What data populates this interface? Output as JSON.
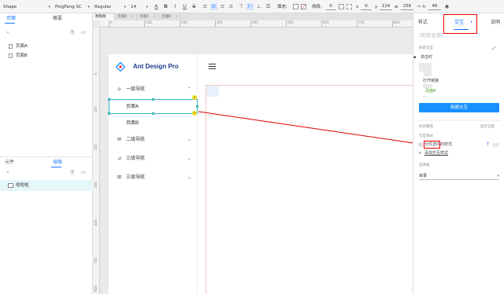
{
  "toolbar": {
    "shape_select": "Shape",
    "font_family": "PingFang SC",
    "font_weight": "Regular",
    "font_size": "14",
    "fill_label": "填充:",
    "stroke_label": "线段:",
    "stroke_width": "0",
    "x_value": "0",
    "y_value": "124",
    "w_value": "256",
    "h_value": "46",
    "icons": [
      "text-color-icon",
      "bold-icon",
      "italic-icon",
      "underline-icon",
      "strikethrough-icon",
      "align-left-icon",
      "align-center-icon",
      "align-right-icon",
      "align-justify-icon",
      "valign-top-icon",
      "valign-middle-icon",
      "valign-bottom-icon",
      "list-icon",
      "lock-icon",
      "eye-icon"
    ]
  },
  "left_panel": {
    "tabs": [
      "页面",
      "概要"
    ],
    "pages": [
      "页面A",
      "页面B"
    ],
    "bottom_tabs": [
      "元件",
      "母版"
    ],
    "masters": [
      "啦啦啦"
    ]
  },
  "canvas": {
    "doc_tabs": [
      "啦啦啦",
      "页面B",
      "页面A",
      "页面B"
    ],
    "ruler_h": [
      "0",
      "100",
      "200",
      "300",
      "400",
      "500",
      "600",
      "700",
      "800"
    ],
    "ruler_v": [
      "0",
      "100",
      "200",
      "300",
      "400",
      "500",
      "600"
    ],
    "logo_text": "Ant Design Pro",
    "nav": [
      {
        "label": "一级导航",
        "icon": "home-icon",
        "expanded": true
      },
      {
        "label": "二级导航",
        "icon": "mail-icon"
      },
      {
        "label": "三级导航",
        "icon": "chart-icon"
      },
      {
        "label": "三级导航",
        "icon": "table-icon"
      }
    ],
    "sub_items": [
      "页面A",
      "页面B"
    ],
    "badges": [
      "⚡",
      "⚡"
    ]
  },
  "right_panel": {
    "tabs": [
      "样式",
      "交互",
      "说明"
    ],
    "tab_dot": "•",
    "shape_name_placeholder": "(矩形名称)",
    "shape_interaction_label": "形状交互",
    "on_click_label": "单击时",
    "open_link_label": "打开链接",
    "link_target": "页面A",
    "new_interaction_button": "新建交互",
    "shape_props_label": "形状属性",
    "show_all_label": "显示全部",
    "interaction_style_label": "交互样式",
    "selected_style_text": "元件选中的样式",
    "add_style_text": "添加交互样式",
    "option_group_label": "选项组",
    "option_group_value": "目录",
    "t_label": "T",
    "colors": {
      "accent": "#1677ff",
      "highlight": "#ff0000",
      "selection": "#37b8c9"
    }
  }
}
